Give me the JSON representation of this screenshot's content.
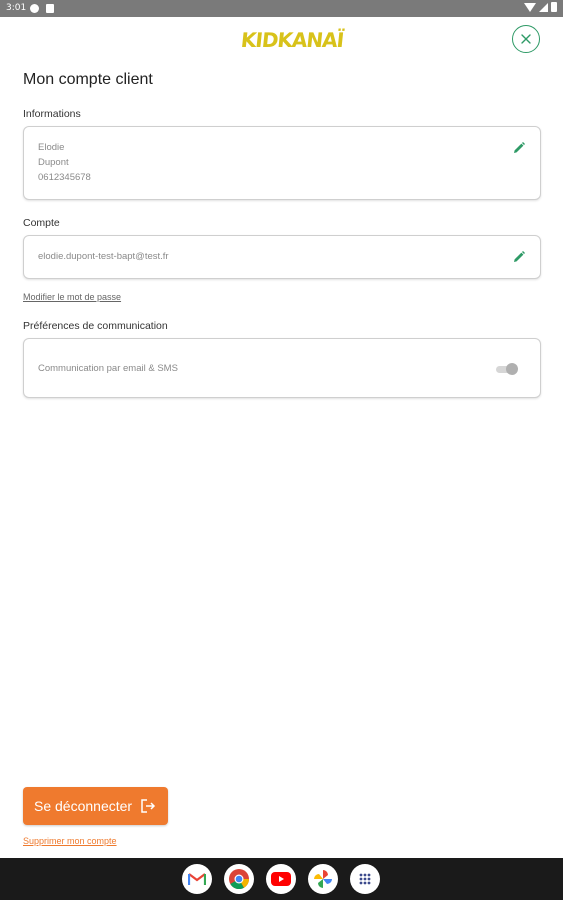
{
  "status_bar": {
    "time": "3:01"
  },
  "header": {
    "logo_text": "KIDKANAÏ",
    "close_icon": "close-icon"
  },
  "page": {
    "title": "Mon compte client"
  },
  "informations": {
    "label": "Informations",
    "first_name": "Elodie",
    "last_name": "Dupont",
    "phone": "0612345678"
  },
  "compte": {
    "label": "Compte",
    "email": "elodie.dupont-test-bapt@test.fr",
    "change_password_link": "Modifier le mot de passe"
  },
  "preferences": {
    "label": "Préférences de communication",
    "option_label": "Communication par email & SMS",
    "option_enabled": false
  },
  "actions": {
    "logout_label": "Se déconnecter",
    "delete_account_link": "Supprimer mon compte"
  },
  "colors": {
    "accent_green": "#2e9a66",
    "accent_orange": "#ef7a2e",
    "logo_yellow": "#d8c21a"
  },
  "taskbar": {
    "apps": [
      "gmail-icon",
      "chrome-icon",
      "youtube-icon",
      "photos-icon",
      "app-drawer-icon"
    ]
  }
}
